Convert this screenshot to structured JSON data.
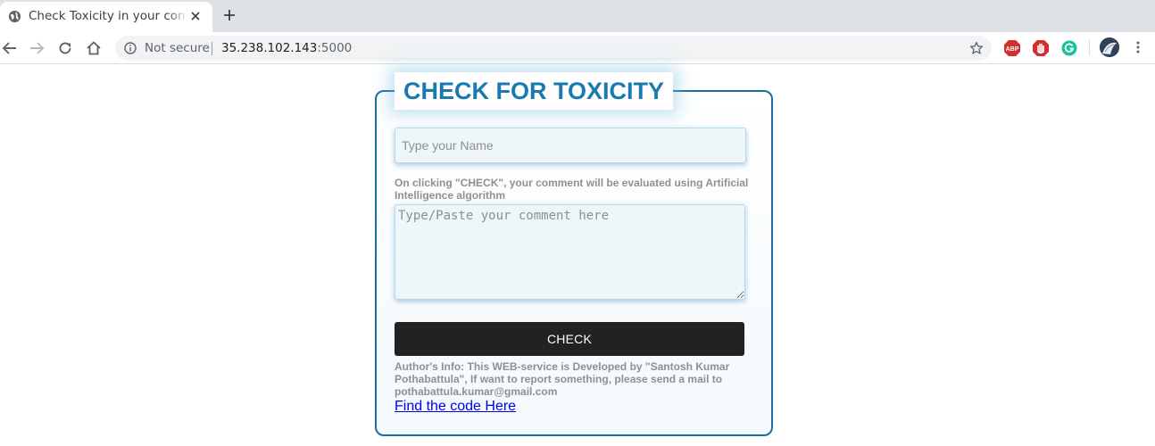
{
  "browser": {
    "tab_title": "Check Toxicity in your comments",
    "security_label": "Not secure",
    "url_host": "35.238.102.143",
    "url_port": ":5000",
    "extensions": [
      "adblock-plus-icon",
      "stop-hand-icon",
      "grammarly-icon"
    ]
  },
  "colors": {
    "accent": "#1a7ab0",
    "card_border": "#1c6e9e",
    "button_bg": "#222222",
    "hint_text": "#909090",
    "link": "#0000ee"
  },
  "form": {
    "title": "CHECK FOR TOXICITY",
    "name_placeholder": "Type your Name",
    "hint": "On clicking \"CHECK\", your comment will be evaluated using Artificial Intelligence algorithm",
    "comment_placeholder": "Type/Paste your comment here",
    "check_label": "CHECK",
    "author_info": "Author's Info: This WEB-service is Developed by \"Santosh Kumar Pothabattula\", If want to report something, please send a mail to pothabattula.kumar@gmail.com",
    "code_link": "Find the code Here"
  }
}
